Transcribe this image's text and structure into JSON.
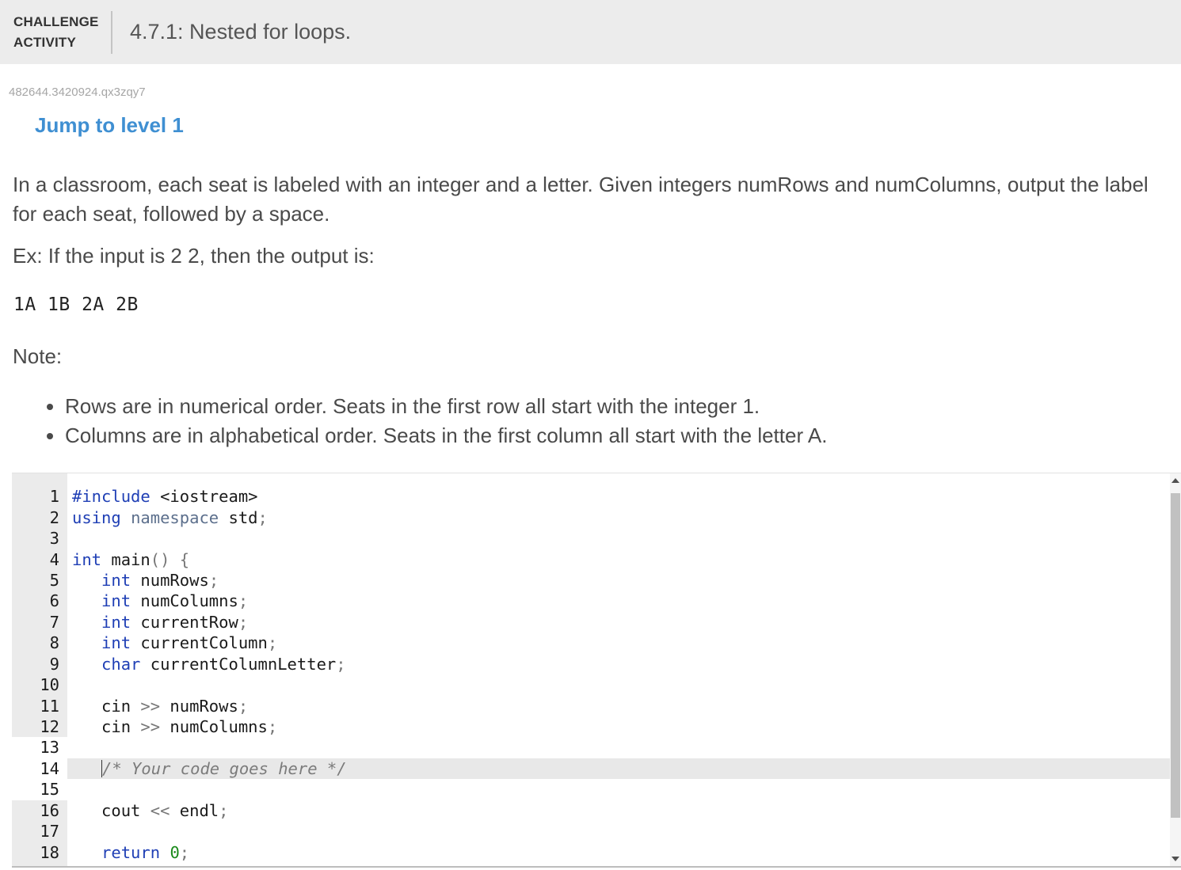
{
  "header": {
    "badge_line1": "CHALLENGE",
    "badge_line2": "ACTIVITY",
    "title": "4.7.1: Nested for loops."
  },
  "activity_id": "482644.3420924.qx3zqy7",
  "jump_link": "Jump to level 1",
  "instructions": {
    "paragraph1": "In a classroom, each seat is labeled with an integer and a letter. Given integers numRows and numColumns, output the label for each seat, followed by a space.",
    "paragraph2": "Ex: If the input is 2 2, then the output is:",
    "example_output": "1A 1B 2A 2B",
    "note_label": "Note:",
    "notes": [
      "Rows are in numerical order. Seats in the first row all start with the integer 1.",
      "Columns are in alphabetical order. Seats in the first column all start with the letter A."
    ]
  },
  "editor": {
    "colors": {
      "keyword": "#1f3fb5",
      "type": "#1f3fb5",
      "namespace": "#5c6f8c",
      "comment": "#7b7b7b",
      "number": "#1a8a1a",
      "punct": "#777777",
      "text": "#1a1a1a"
    },
    "lines": [
      {
        "num": "1",
        "tokens": [
          {
            "t": "#include",
            "c": "keyword"
          },
          {
            "t": " <iostream>",
            "c": "text"
          }
        ]
      },
      {
        "num": "2",
        "tokens": [
          {
            "t": "using",
            "c": "keyword"
          },
          {
            "t": " ",
            "c": "text"
          },
          {
            "t": "namespace",
            "c": "namespace"
          },
          {
            "t": " std",
            "c": "text"
          },
          {
            "t": ";",
            "c": "punct"
          }
        ]
      },
      {
        "num": "3",
        "tokens": []
      },
      {
        "num": "4",
        "tokens": [
          {
            "t": "int",
            "c": "type"
          },
          {
            "t": " main",
            "c": "text"
          },
          {
            "t": "() {",
            "c": "punct"
          }
        ]
      },
      {
        "num": "5",
        "tokens": [
          {
            "t": "   ",
            "c": "text"
          },
          {
            "t": "int",
            "c": "type"
          },
          {
            "t": " numRows",
            "c": "text"
          },
          {
            "t": ";",
            "c": "punct"
          }
        ]
      },
      {
        "num": "6",
        "tokens": [
          {
            "t": "   ",
            "c": "text"
          },
          {
            "t": "int",
            "c": "type"
          },
          {
            "t": " numColumns",
            "c": "text"
          },
          {
            "t": ";",
            "c": "punct"
          }
        ]
      },
      {
        "num": "7",
        "tokens": [
          {
            "t": "   ",
            "c": "text"
          },
          {
            "t": "int",
            "c": "type"
          },
          {
            "t": " currentRow",
            "c": "text"
          },
          {
            "t": ";",
            "c": "punct"
          }
        ]
      },
      {
        "num": "8",
        "tokens": [
          {
            "t": "   ",
            "c": "text"
          },
          {
            "t": "int",
            "c": "type"
          },
          {
            "t": " currentColumn",
            "c": "text"
          },
          {
            "t": ";",
            "c": "punct"
          }
        ]
      },
      {
        "num": "9",
        "tokens": [
          {
            "t": "   ",
            "c": "text"
          },
          {
            "t": "char",
            "c": "type"
          },
          {
            "t": " currentColumnLetter",
            "c": "text"
          },
          {
            "t": ";",
            "c": "punct"
          }
        ]
      },
      {
        "num": "10",
        "tokens": []
      },
      {
        "num": "11",
        "tokens": [
          {
            "t": "   cin ",
            "c": "text"
          },
          {
            "t": ">>",
            "c": "punct"
          },
          {
            "t": " numRows",
            "c": "text"
          },
          {
            "t": ";",
            "c": "punct"
          }
        ]
      },
      {
        "num": "12",
        "tokens": [
          {
            "t": "   cin ",
            "c": "text"
          },
          {
            "t": ">>",
            "c": "punct"
          },
          {
            "t": " numColumns",
            "c": "text"
          },
          {
            "t": ";",
            "c": "punct"
          }
        ]
      },
      {
        "num": "13",
        "tokens": [],
        "active": true
      },
      {
        "num": "14",
        "tokens": [
          {
            "t": "   ",
            "c": "text"
          },
          {
            "t": "CURSOR",
            "c": "cursor"
          },
          {
            "t": "/* Your code goes here */",
            "c": "comment"
          }
        ],
        "active": true,
        "cursor_line": true
      },
      {
        "num": "15",
        "tokens": [],
        "active": true
      },
      {
        "num": "16",
        "tokens": [
          {
            "t": "   cout ",
            "c": "text"
          },
          {
            "t": "<<",
            "c": "punct"
          },
          {
            "t": " endl",
            "c": "text"
          },
          {
            "t": ";",
            "c": "punct"
          }
        ]
      },
      {
        "num": "17",
        "tokens": []
      },
      {
        "num": "18",
        "tokens": [
          {
            "t": "   ",
            "c": "text"
          },
          {
            "t": "return",
            "c": "keyword"
          },
          {
            "t": " ",
            "c": "text"
          },
          {
            "t": "0",
            "c": "number"
          },
          {
            "t": ";",
            "c": "punct"
          }
        ]
      }
    ]
  }
}
